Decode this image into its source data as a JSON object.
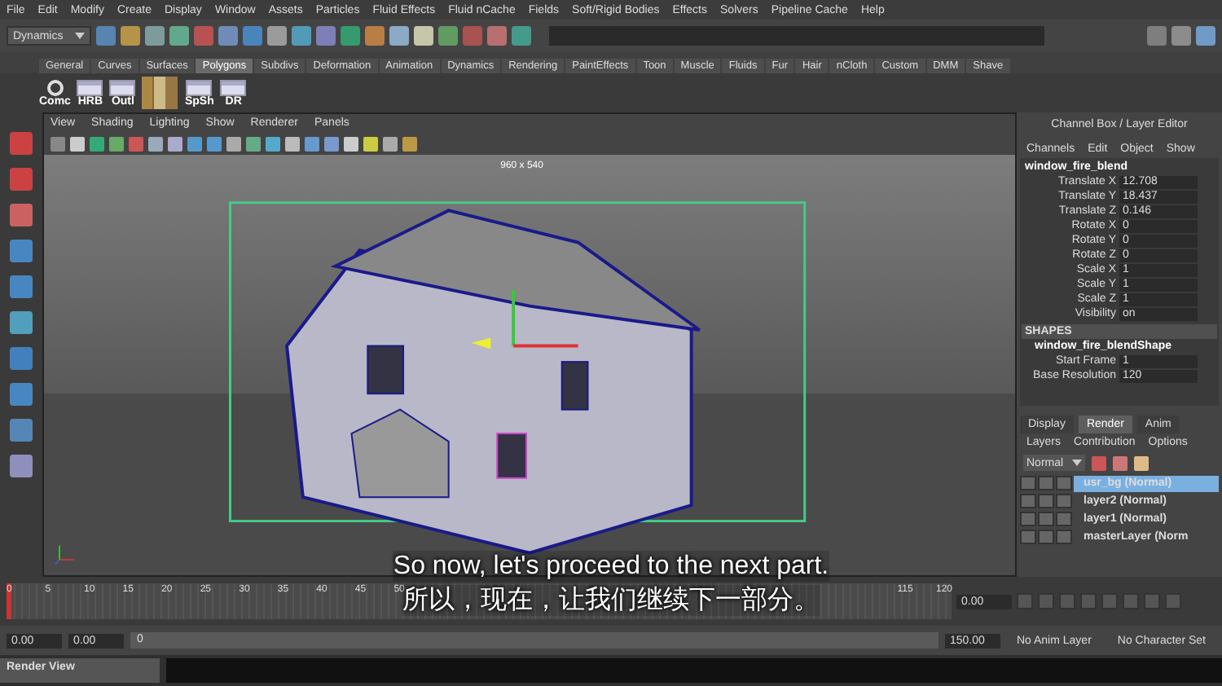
{
  "menu": [
    "File",
    "Edit",
    "Modify",
    "Create",
    "Display",
    "Window",
    "Assets",
    "Particles",
    "Fluid Effects",
    "Fluid nCache",
    "Fields",
    "Soft/Rigid Bodies",
    "Effects",
    "Solvers",
    "Pipeline Cache",
    "Help"
  ],
  "mode_dropdown": "Dynamics",
  "shelf_tabs": [
    {
      "label": "General",
      "selected": false
    },
    {
      "label": "Curves",
      "selected": false
    },
    {
      "label": "Surfaces",
      "selected": false
    },
    {
      "label": "Polygons",
      "selected": true
    },
    {
      "label": "Subdivs",
      "selected": false
    },
    {
      "label": "Deformation",
      "selected": false
    },
    {
      "label": "Animation",
      "selected": false
    },
    {
      "label": "Dynamics",
      "selected": false
    },
    {
      "label": "Rendering",
      "selected": false
    },
    {
      "label": "PaintEffects",
      "selected": false
    },
    {
      "label": "Toon",
      "selected": false
    },
    {
      "label": "Muscle",
      "selected": false
    },
    {
      "label": "Fluids",
      "selected": false
    },
    {
      "label": "Fur",
      "selected": false
    },
    {
      "label": "Hair",
      "selected": false
    },
    {
      "label": "nCloth",
      "selected": false
    },
    {
      "label": "Custom",
      "selected": false
    },
    {
      "label": "DMM",
      "selected": false
    },
    {
      "label": "Shave",
      "selected": false
    }
  ],
  "shelf_buttons": [
    {
      "kind": "script",
      "label": "Comc"
    },
    {
      "kind": "window",
      "label": "HRB"
    },
    {
      "kind": "window",
      "label": "Outl"
    },
    {
      "kind": "books"
    },
    {
      "kind": "window",
      "label": "SpSh"
    },
    {
      "kind": "window",
      "label": "DR"
    }
  ],
  "panel_menu": [
    "View",
    "Shading",
    "Lighting",
    "Show",
    "Renderer",
    "Panels"
  ],
  "resolution_label": "960 x 540",
  "channel_box": {
    "title": "Channel Box / Layer Editor",
    "menu": [
      "Channels",
      "Edit",
      "Object",
      "Show"
    ],
    "object": "window_fire_blend",
    "attributes": [
      {
        "name": "Translate X",
        "value": "12.708"
      },
      {
        "name": "Translate Y",
        "value": "18.437"
      },
      {
        "name": "Translate Z",
        "value": "0.146"
      },
      {
        "name": "Rotate X",
        "value": "0"
      },
      {
        "name": "Rotate Y",
        "value": "0"
      },
      {
        "name": "Rotate Z",
        "value": "0"
      },
      {
        "name": "Scale X",
        "value": "1"
      },
      {
        "name": "Scale Y",
        "value": "1"
      },
      {
        "name": "Scale Z",
        "value": "1"
      },
      {
        "name": "Visibility",
        "value": "on"
      }
    ],
    "shapes_heading": "SHAPES",
    "shape": "window_fire_blendShape",
    "shape_attributes": [
      {
        "name": "Start Frame",
        "value": "1"
      },
      {
        "name": "Base Resolution",
        "value": "120"
      }
    ]
  },
  "layer_editor": {
    "tabs": [
      {
        "label": "Display",
        "selected": false
      },
      {
        "label": "Render",
        "selected": true
      },
      {
        "label": "Anim",
        "selected": false
      }
    ],
    "menu": [
      "Layers",
      "Contribution",
      "Options"
    ],
    "blend_mode": "Normal",
    "layers": [
      {
        "name": "usr_bg (Normal)",
        "selected": true
      },
      {
        "name": "layer2 (Normal)",
        "selected": false
      },
      {
        "name": "layer1 (Normal)",
        "selected": false
      },
      {
        "name": "masterLayer (Norm",
        "selected": false
      }
    ]
  },
  "time_slider": {
    "ticks": [
      "0",
      "5",
      "10",
      "15",
      "20",
      "25",
      "30",
      "35",
      "40",
      "45",
      "50",
      "115",
      "120"
    ],
    "current_frame": "0.00",
    "level": 0
  },
  "range_slider": {
    "start": "0.00",
    "playback_start": "0.00",
    "slider_value": "0",
    "level": 1,
    "end": "150.00",
    "anim_layer": "No Anim Layer",
    "character_set": "No Character Set"
  },
  "taskbar": {
    "window": "Render View"
  },
  "subtitles": [
    "So now, let's proceed to the next part.",
    "所以，现在，让我们继续下一部分。"
  ]
}
